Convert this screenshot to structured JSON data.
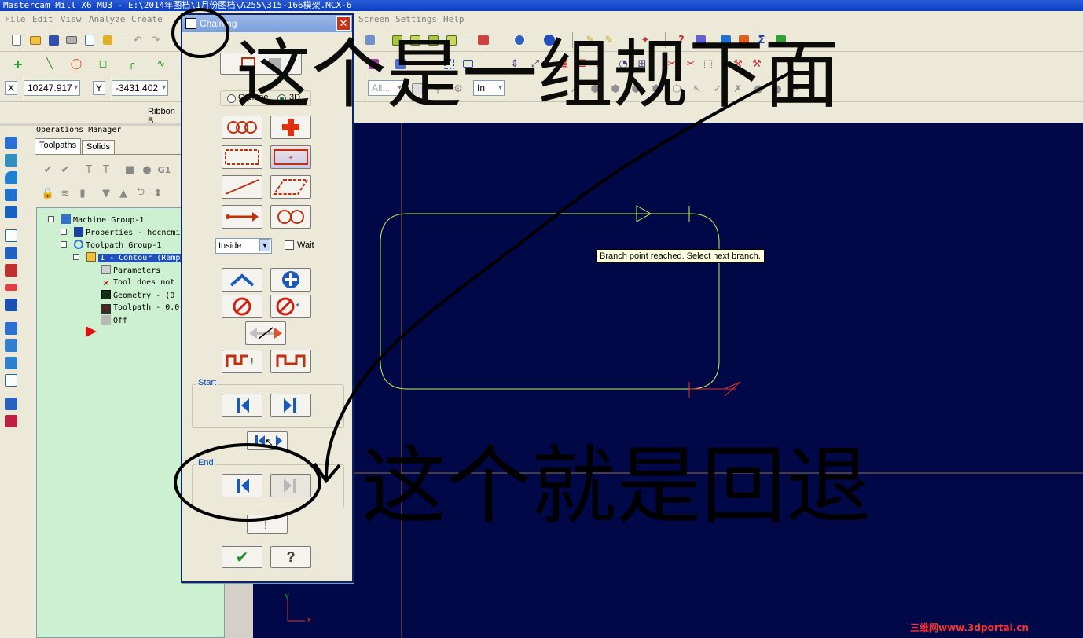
{
  "window": {
    "title": "Mastercam Mill X6 MU3 - E:\\2014年图档\\1月份图档\\A255\\315-166模架.MCX-6"
  },
  "menu": [
    {
      "label": "File"
    },
    {
      "label": "Edit"
    },
    {
      "label": "View"
    },
    {
      "label": "Analyze"
    },
    {
      "label": "Create"
    },
    {
      "label": "Screen"
    },
    {
      "label": "Settings"
    },
    {
      "label": "Help"
    }
  ],
  "coords": {
    "x_label": "X",
    "x_value": "10247.917",
    "y_label": "Y",
    "y_value": "-3431.402"
  },
  "ribbon": {
    "label": "Ribbon B"
  },
  "general_selection": {
    "all_label": "All...",
    "in_label": "In"
  },
  "ops_manager": {
    "title": "Operations Manager",
    "tabs": [
      {
        "label": "Toolpaths",
        "active": true
      },
      {
        "label": "Solids",
        "active": false
      }
    ],
    "tree": [
      {
        "label": "Machine Group-1",
        "icon": "machine-group-icon"
      },
      {
        "label": "Properties - hccncmi",
        "icon": "properties-icon"
      },
      {
        "label": "Toolpath Group-1",
        "icon": "toolpath-group-icon"
      },
      {
        "label": "1 - Contour (Ramp",
        "icon": "folder-icon",
        "selected": true
      },
      {
        "label": "Parameters",
        "icon": "parameters-icon"
      },
      {
        "label": "Tool does not",
        "icon": "tool-missing-icon"
      },
      {
        "label": "Geometry - (0",
        "icon": "geometry-icon"
      },
      {
        "label": "Toolpath - 0.0",
        "icon": "toolpath-dirty-icon"
      },
      {
        "label": "Off",
        "icon": "off-icon"
      }
    ]
  },
  "chaining_dialog": {
    "title": "Chaining",
    "close_label": "✕",
    "cplane_label": "C-plane",
    "threed_label": "3D",
    "mode_selected": "3D",
    "inside_value": "Inside",
    "wait_label": "Wait",
    "start_label": "Start",
    "end_label": "End",
    "ok_label": "✔",
    "help_label": "?"
  },
  "viewport": {
    "tooltip": "Branch point reached.  Select next branch.",
    "axis_y": "Y",
    "axis_x": "X"
  },
  "annotations": {
    "note_top": "这个是一组规下面",
    "note_bottom": "这个就是回退"
  },
  "watermark": "三维网www.3dportal.cn",
  "colors": {
    "graphics_bg": "#000848",
    "geometry": "#c8f050",
    "tree_bg": "#ccf0d0",
    "chain_arrow": "#e03030"
  }
}
